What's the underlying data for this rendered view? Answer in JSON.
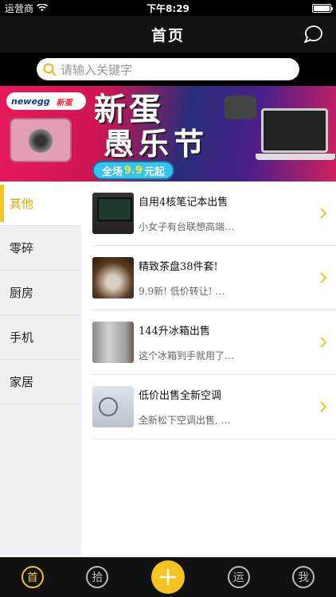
{
  "status_bar": {
    "carrier": "运营商",
    "time": "下午8:29",
    "battery_level": 1.0
  },
  "nav": {
    "title": "首页"
  },
  "search": {
    "placeholder": "请输入关键字"
  },
  "banner": {
    "logo_brand": "newegg",
    "logo_suffix": "新蛋",
    "title_line1": "新蛋",
    "title_line2": "愚乐节",
    "ribbon_prefix": "全场",
    "ribbon_price": "9.9",
    "ribbon_suffix": "元起"
  },
  "sidebar": {
    "items": [
      {
        "label": "其他",
        "active": true
      },
      {
        "label": "零碎",
        "active": false
      },
      {
        "label": "厨房",
        "active": false
      },
      {
        "label": "手机",
        "active": false
      },
      {
        "label": "家居",
        "active": false
      }
    ]
  },
  "listings": [
    {
      "title": "自用4核笔记本出售",
      "desc": "小女子有台联想高端…"
    },
    {
      "title": "精致茶盘38件套!",
      "desc": "9.9新! 低价转让! …"
    },
    {
      "title": "144升冰箱出售",
      "desc": "这个冰箱到手就用了…"
    },
    {
      "title": "低价出售全新空调",
      "desc": "全新松下空调出售, …"
    }
  ],
  "tabs": [
    {
      "label": "首",
      "active": true
    },
    {
      "label": "拾",
      "active": false
    },
    {
      "label": "+",
      "active": false
    },
    {
      "label": "运",
      "active": false
    },
    {
      "label": "我",
      "active": false
    }
  ],
  "colors": {
    "accent": "#f5c422",
    "nav_bg": "#121212",
    "sidebar_bg": "#efeff4"
  }
}
